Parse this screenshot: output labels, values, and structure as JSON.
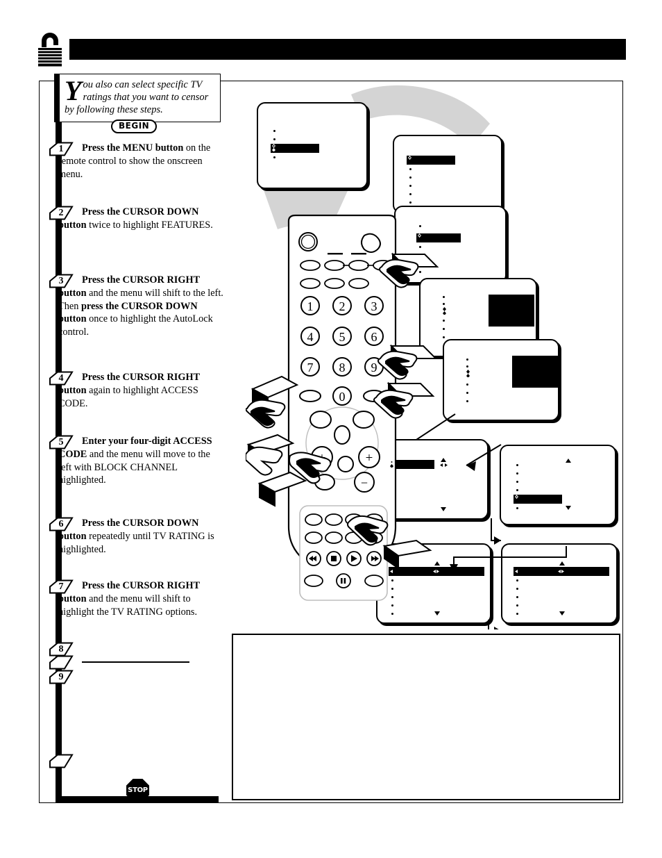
{
  "page": {
    "header_title": "",
    "lock_icon": "padlock-icon"
  },
  "intro": {
    "dropcap": "Y",
    "text": "ou also can select specific TV ratings that you want to censor by following these steps."
  },
  "begin_badge": {
    "label": "BEGIN"
  },
  "stop_badge": {
    "label": "STOP"
  },
  "steps": [
    {
      "number": "1",
      "html": "<b>Press the MENU button</b> on the remote control to show the onscreen menu."
    },
    {
      "number": "2",
      "html": "<b>Press the CURSOR DOWN button</b> twice to highlight FEATURES."
    },
    {
      "number": "3",
      "html": "<b>Press the CURSOR RIGHT button</b> and the menu will shift to the left. Then <b>press the CURSOR DOWN button</b> once to highlight the AutoLock control."
    },
    {
      "number": "4",
      "html": "<b>Press the CURSOR RIGHT button</b> again to highlight ACCESS CODE."
    },
    {
      "number": "5",
      "html": "<b>Enter your four-digit ACCESS CODE</b> and the menu will move to the left with BLOCK CHANNEL highlighted."
    },
    {
      "number": "6",
      "html": "<b>Press the CURSOR DOWN button</b> repeatedly until TV RATING is highlighted."
    },
    {
      "number": "7",
      "html": "<b>Press the CURSOR RIGHT button</b> and the menu will shift to highlight the TV RATING options."
    },
    {
      "number": "8",
      "html": ""
    },
    {
      "number": "9",
      "html": ""
    }
  ],
  "extra_markers": [
    {
      "number": ""
    },
    {
      "number": ""
    }
  ],
  "remote": {
    "name": "remote-control-illustration",
    "keypad": [
      "1",
      "2",
      "3",
      "4",
      "5",
      "6",
      "7",
      "8",
      "9",
      "0"
    ],
    "plus_labels": [
      "+",
      "+"
    ],
    "minus_label": "−",
    "transport": [
      "rewind",
      "stop",
      "play",
      "pause"
    ]
  },
  "tv_screens": [
    {
      "name": "main-menu-screen",
      "items_before": 2,
      "highlight_index": 2,
      "items_after": 1,
      "highlight_label": ""
    },
    {
      "name": "features-menu-screen",
      "items_before": 0,
      "highlight_index": 0,
      "items_after": 5,
      "highlight_label": ""
    },
    {
      "name": "autolock-menu-screen",
      "items_before": 1,
      "highlight_index": 1,
      "items_after": 4,
      "highlight_label": ""
    },
    {
      "name": "access-code-screen",
      "items_before": 2,
      "highlight_index": 2,
      "items_after": 3,
      "highlight_label": ""
    },
    {
      "name": "access-code-entry-screen",
      "items_before": 2,
      "highlight_index": 2,
      "items_after": 3,
      "highlight_label": ""
    },
    {
      "name": "block-channel-screen",
      "items_before": 0,
      "highlight_index": 0,
      "items_after": 5,
      "highlight_label": ""
    },
    {
      "name": "tv-rating-highlight-screen",
      "items_before": 4,
      "highlight_index": 4,
      "items_after": 1,
      "highlight_label": ""
    },
    {
      "name": "tv-rating-options-screen-left",
      "items_before": 0,
      "highlight_index": 0,
      "items_after": 6,
      "highlight_label": ""
    },
    {
      "name": "tv-rating-options-screen-right",
      "items_before": 0,
      "highlight_index": 0,
      "items_after": 6,
      "highlight_label": ""
    }
  ],
  "note_box": {
    "text": ""
  },
  "colors": {
    "ink": "#000000",
    "paper": "#ffffff",
    "beam_gray": "#d4d4d4"
  }
}
